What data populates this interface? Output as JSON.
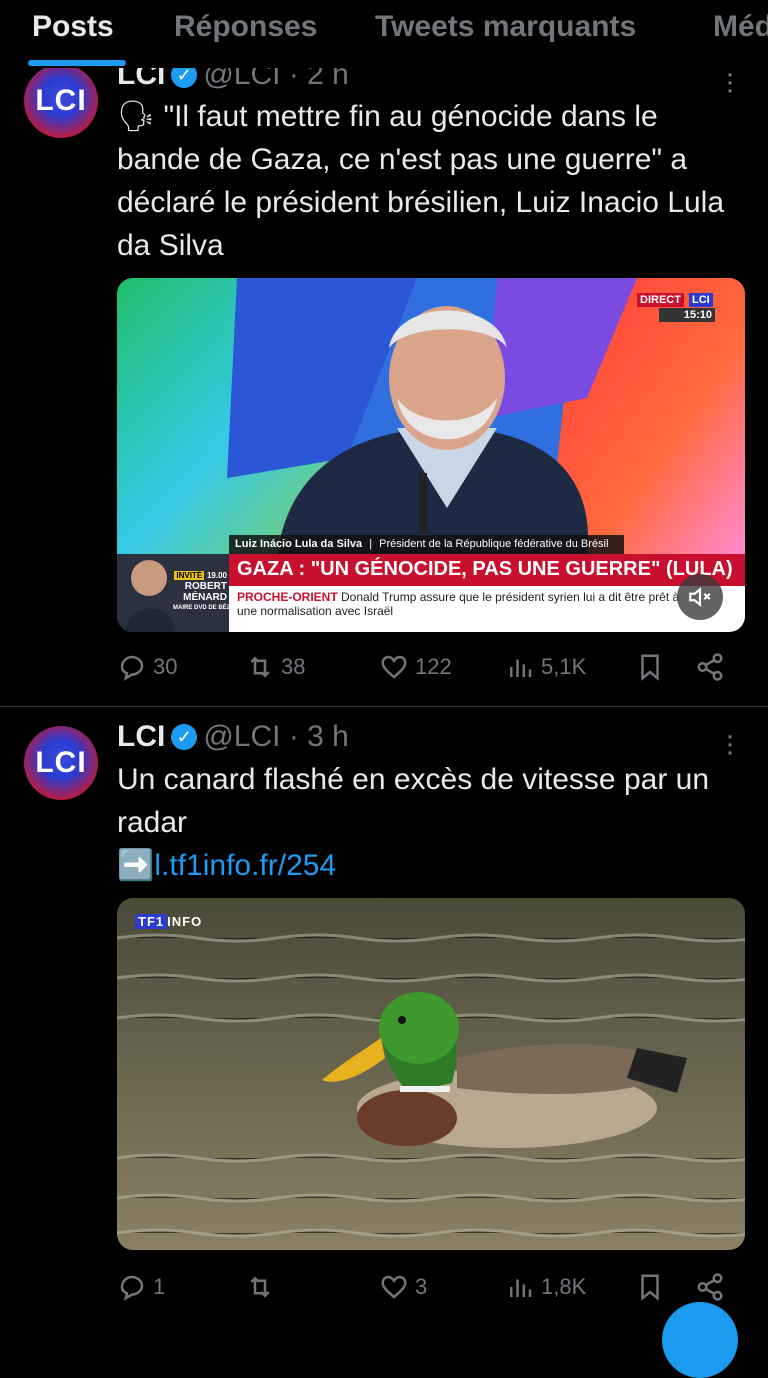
{
  "tabs": [
    {
      "label": "Posts",
      "active": true
    },
    {
      "label": "Réponses",
      "active": false
    },
    {
      "label": "Tweets marquants",
      "active": false
    },
    {
      "label": "Méd",
      "active": false
    }
  ],
  "tweets": [
    {
      "avatar_text": "LCI",
      "name": "LCI",
      "handle": "@LCI",
      "separator": "·",
      "time": "2 h",
      "emoji": "🗣",
      "text": "\"Il faut mettre fin au génocide dans le bande de Gaza, ce n'est pas une guerre\" a déclaré le président brésilien, Luiz Inacio Lula da Silva",
      "media": {
        "direct": "DIRECT",
        "logo": "LCI",
        "clock": "15:10",
        "lower_third_name": "Luiz Inácio Lula da Silva",
        "lower_third_title": "Président de la République fédérative du Brésil",
        "headline": "GAZA : \"UN GÉNOCIDE, PAS UNE GUERRE\" (LULA)",
        "ticker_tag": "PROCHE-ORIENT",
        "ticker_text": "Donald Trump assure que le président syrien lui a dit être prêt à une normalisation avec Israël",
        "guest_badge": "INVITÉ",
        "guest_time": "19.00",
        "guest_name1": "ROBERT",
        "guest_name2": "MÉNARD",
        "guest_role": "MAIRE DVD DE BÉZIERS",
        "mute_icon": "mute-icon"
      },
      "stats": {
        "replies": "30",
        "retweets": "38",
        "likes": "122",
        "views": "5,1K"
      }
    },
    {
      "avatar_text": "LCI",
      "name": "LCI",
      "handle": "@LCI",
      "separator": "·",
      "time": "3 h",
      "text": "Un canard flashé en excès de vitesse par un radar",
      "link_emoji": "➡️",
      "link": "l.tf1info.fr/254",
      "media": {
        "watermark_tf1": "TF1",
        "watermark_info": "INFO"
      },
      "stats": {
        "replies": "1",
        "retweets": "",
        "likes": "3",
        "views": "1,8K"
      }
    }
  ],
  "colors": {
    "accent": "#1d9bf0",
    "background": "#000000",
    "muted": "#71767b",
    "headline_red": "#c8102e"
  }
}
